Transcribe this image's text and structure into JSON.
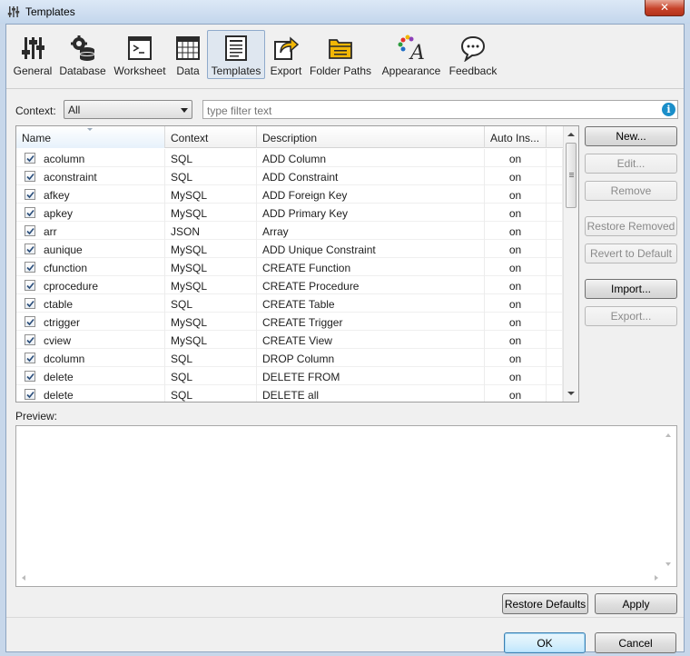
{
  "window": {
    "title": "Templates",
    "close": "✕"
  },
  "toolbar": [
    {
      "label": "General",
      "icon": "sliders-icon"
    },
    {
      "label": "Database",
      "icon": "database-gear-icon"
    },
    {
      "label": "Worksheet",
      "icon": "terminal-icon"
    },
    {
      "label": "Data",
      "icon": "grid-icon"
    },
    {
      "label": "Templates",
      "icon": "document-lines-icon",
      "selected": true
    },
    {
      "label": "Export",
      "icon": "export-arrow-icon"
    },
    {
      "label": "Folder Paths",
      "icon": "folder-icon"
    },
    {
      "label": "Appearance",
      "icon": "palette-font-icon"
    },
    {
      "label": "Feedback",
      "icon": "speech-bubble-icon"
    }
  ],
  "filter": {
    "context_label": "Context:",
    "context_value": "All",
    "placeholder": "type filter text"
  },
  "table": {
    "columns": {
      "name": "Name",
      "context": "Context",
      "description": "Description",
      "auto_insert": "Auto Ins..."
    },
    "rows": [
      {
        "name": "acolumn",
        "context": "SQL",
        "description": "ADD Column",
        "auto": "on"
      },
      {
        "name": "aconstraint",
        "context": "SQL",
        "description": "ADD Constraint",
        "auto": "on"
      },
      {
        "name": "afkey",
        "context": "MySQL",
        "description": "ADD Foreign Key",
        "auto": "on"
      },
      {
        "name": "apkey",
        "context": "MySQL",
        "description": "ADD Primary Key",
        "auto": "on"
      },
      {
        "name": "arr",
        "context": "JSON",
        "description": "Array",
        "auto": "on"
      },
      {
        "name": "aunique",
        "context": "MySQL",
        "description": "ADD Unique Constraint",
        "auto": "on"
      },
      {
        "name": "cfunction",
        "context": "MySQL",
        "description": "CREATE Function",
        "auto": "on"
      },
      {
        "name": "cprocedure",
        "context": "MySQL",
        "description": "CREATE Procedure",
        "auto": "on"
      },
      {
        "name": "ctable",
        "context": "SQL",
        "description": "CREATE Table",
        "auto": "on"
      },
      {
        "name": "ctrigger",
        "context": "MySQL",
        "description": "CREATE Trigger",
        "auto": "on"
      },
      {
        "name": "cview",
        "context": "MySQL",
        "description": "CREATE View",
        "auto": "on"
      },
      {
        "name": "dcolumn",
        "context": "SQL",
        "description": "DROP Column",
        "auto": "on"
      },
      {
        "name": "delete",
        "context": "SQL",
        "description": "DELETE FROM",
        "auto": "on"
      },
      {
        "name": "delete",
        "context": "SQL",
        "description": "DELETE all",
        "auto": "on"
      }
    ]
  },
  "side_buttons": {
    "new": "New...",
    "edit": "Edit...",
    "remove": "Remove",
    "restore_removed": "Restore Removed",
    "revert": "Revert to Default",
    "import": "Import...",
    "export": "Export..."
  },
  "preview": {
    "label": "Preview:"
  },
  "footer": {
    "restore_defaults": "Restore Defaults",
    "apply": "Apply",
    "ok": "OK",
    "cancel": "Cancel"
  }
}
